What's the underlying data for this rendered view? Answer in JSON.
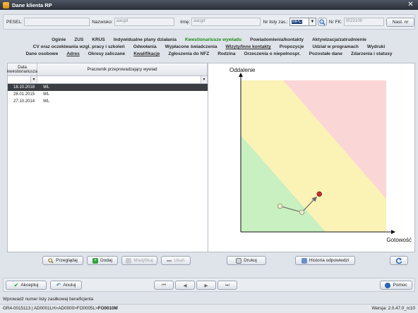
{
  "window": {
    "title": "Dane klienta RP",
    "close_glyph": "✕"
  },
  "header": {
    "pesel_label": "PESEL:",
    "pesel_value": "",
    "surname_label": "Nazwisko:",
    "surname_value": "aacgd",
    "name_label": "Imię:",
    "name_value": "aacgd",
    "list_label": "Nr listy zas.:",
    "list_value": "MPC",
    "fk_label": "Nr FK:",
    "fk_value": "0022100",
    "next_button": "Nast. nr"
  },
  "tabs": {
    "row1": [
      "Oginie",
      "ZUS",
      "KRUS",
      "Indywidualne plany działania",
      "Kwestionariusze wywiadu",
      "Powiadomienia/kontakty",
      "Aktywizacja/zatrudnienie"
    ],
    "row2": [
      "CV oraz oczekiwania wzgl. pracy i szkoleń",
      "Odwołania",
      "Wypłacone świadczenia",
      "Wizyty/Inne kontakty",
      "Propozycje",
      "Udział w programach",
      "Wydruki"
    ],
    "row3": [
      "Dane osobowe",
      "Adres",
      "Okresy zaliczane",
      "Kwalifikacje",
      "Zgłoszenia do NFZ",
      "Rodzina",
      "Orzeczenia o niepełnospr.",
      "Pozostałe dane",
      "Zdarzenia i statusy"
    ],
    "active": "Kwestionariusze wywiadu"
  },
  "table": {
    "columns": [
      "Data kwestionariusza",
      "Pracownik przeprowadzający wywiad"
    ],
    "rows": [
      {
        "date": "18.10.2018",
        "worker": "WL"
      },
      {
        "date": "28.01.2015",
        "worker": "WL"
      },
      {
        "date": "27.10.2014",
        "worker": "WL"
      }
    ],
    "selected_index": 0
  },
  "chart_data": {
    "type": "scatter",
    "ylabel": "Oddalenie",
    "xlabel": "Gotowość",
    "zones": [
      {
        "name": "green",
        "color": "#c8f0c0"
      },
      {
        "name": "yellow",
        "color": "#fbf3b6"
      },
      {
        "name": "red",
        "color": "#fbd6d6"
      }
    ],
    "points": [
      {
        "x": 0.27,
        "y": 0.17,
        "color": "#ecebc6"
      },
      {
        "x": 0.42,
        "y": 0.13,
        "color": "#ecebc6"
      },
      {
        "x": 0.54,
        "y": 0.25,
        "color": "#c9302c"
      }
    ]
  },
  "actions": {
    "browse": "Przeglądaj",
    "add": "Dodaj",
    "edit": "Modyfikuj",
    "delete": "Usuń",
    "print": "Drukuj",
    "history": "Historia odpowiedzi"
  },
  "footer": {
    "accept": "Akceptuj",
    "cancel": "Anuluj",
    "help": "Pomoc"
  },
  "hint": "Wprowadź numer listy zasiłkowej beneficjenta",
  "status": {
    "path": "GR4-0015113 | AD0001LH>AD0000>FO0005L>",
    "current": "FO0010M",
    "version": "Wersja: 2.0.47.0_rc10"
  },
  "colors": {
    "accent_green": "#1a8a1a",
    "selection": "#3a3d42"
  }
}
